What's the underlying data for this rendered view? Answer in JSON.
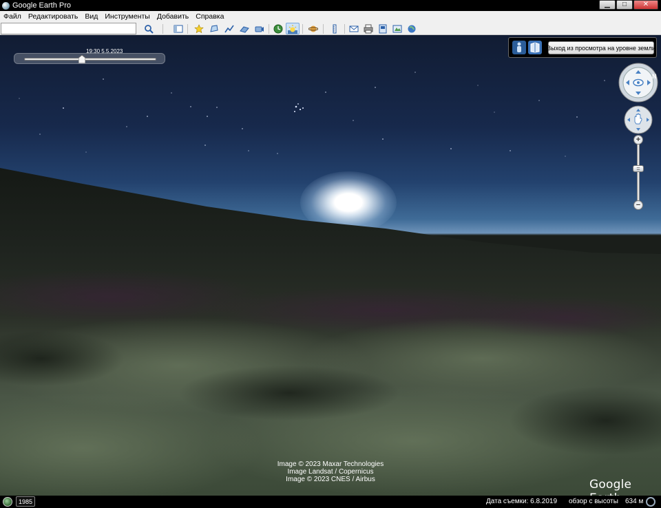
{
  "window": {
    "title": "Google Earth Pro",
    "controls": {
      "minimize": "▁",
      "maximize": "□",
      "close": "✕"
    }
  },
  "menu": {
    "items": [
      "Файл",
      "Редактировать",
      "Вид",
      "Инструменты",
      "Добавить",
      "Справка"
    ]
  },
  "toolbar": {
    "search_value": "",
    "buttons": [
      "search-icon",
      "sidebar-toggle-icon",
      "placemark-icon",
      "polygon-icon",
      "path-icon",
      "image-overlay-icon",
      "tour-record-icon",
      "historical-imagery-icon",
      "sunlight-icon",
      "planets-icon",
      "ruler-icon",
      "email-icon",
      "print-icon",
      "save-image-icon",
      "maps-icon",
      "earth-icon"
    ]
  },
  "time_slider": {
    "label": "19:30 5.5.2023",
    "position_fraction": 0.44
  },
  "ground_level": {
    "exit_label": "Выход из просмотра на уровне земли",
    "icons": [
      "pegman-icon",
      "street-view-icon"
    ]
  },
  "navigation": {
    "north_label": "N",
    "zoom_in": "+",
    "zoom_out": "−",
    "zoom_mid": "="
  },
  "attribution": {
    "lines": [
      "Image © 2023 Maxar Technologies",
      "Image Landsat / Copernicus",
      "Image © 2023 CNES / Airbus"
    ],
    "logo": "Google Earth"
  },
  "status": {
    "year": "1985",
    "imagery_date": "Дата съемки: 6.8.2019",
    "eye_alt_label": "обзор с высоты",
    "eye_alt_value": "634 м"
  },
  "colors": {
    "sky_top": "#111c33",
    "horizon": "#6e93b9",
    "chrome": "#f0f0f0"
  }
}
